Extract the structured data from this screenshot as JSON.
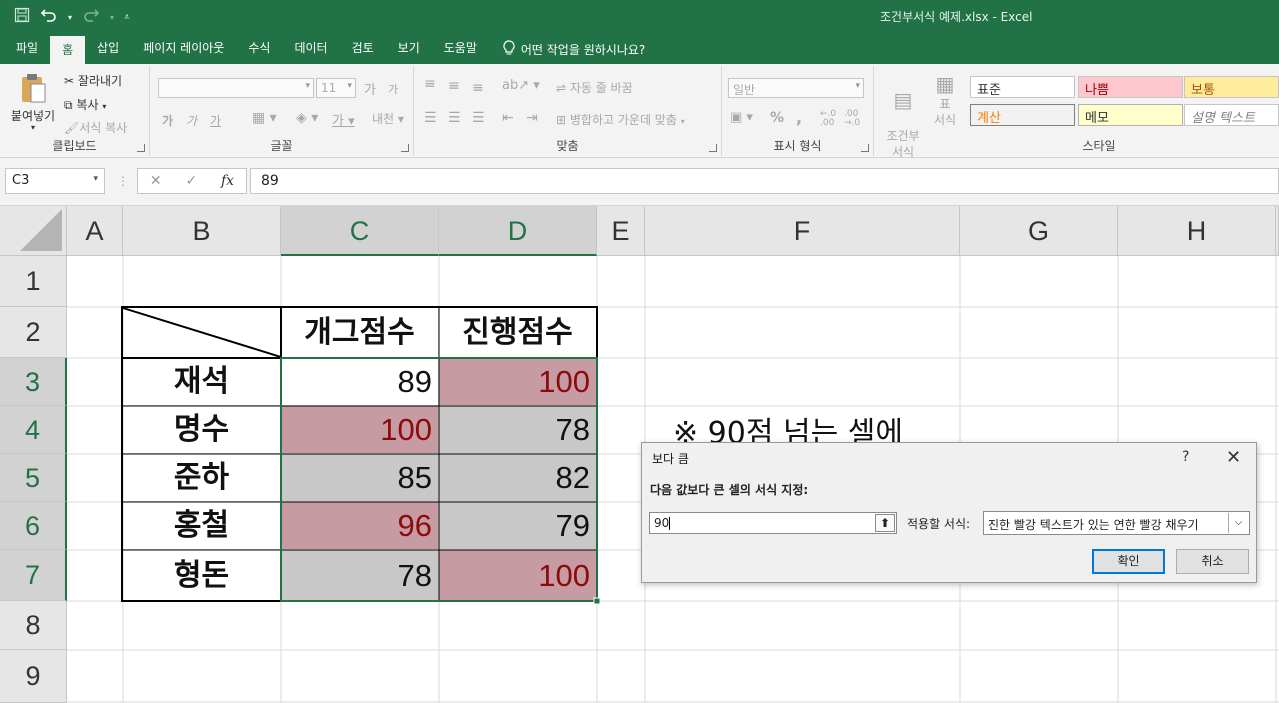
{
  "window": {
    "title": "조건부서식 예제.xlsx  -  Excel"
  },
  "qat": {
    "save_icon": "save-icon",
    "undo_icon": "undo-icon",
    "redo_icon": "redo-icon"
  },
  "tabs": [
    {
      "label": "파일",
      "active": false
    },
    {
      "label": "홈",
      "active": true
    },
    {
      "label": "삽입",
      "active": false
    },
    {
      "label": "페이지 레이아웃",
      "active": false
    },
    {
      "label": "수식",
      "active": false
    },
    {
      "label": "데이터",
      "active": false
    },
    {
      "label": "검토",
      "active": false
    },
    {
      "label": "보기",
      "active": false
    },
    {
      "label": "도움말",
      "active": false
    }
  ],
  "tellme": "어떤 작업을 원하시나요?",
  "ribbon": {
    "clipboard": {
      "paste": "붙여넣기",
      "cut": "잘라내기",
      "copy": "복사",
      "format_painter": "서식 복사",
      "label": "클립보드"
    },
    "font": {
      "font_size": "11",
      "bold": "가",
      "italic": "가",
      "underline": "가",
      "label": "글꼴"
    },
    "align": {
      "wrap": "자동 줄 바꿈",
      "merge": "병합하고 가운데 맞춤",
      "label": "맞춤"
    },
    "number": {
      "format": "일반",
      "percent": "%",
      "comma": ",",
      "label": "표시 형식"
    },
    "styles": {
      "conditional": "조건부\n서식",
      "table": "표\n서식",
      "label": "스타일",
      "items": [
        {
          "text": "표준",
          "bg": "#ffffff",
          "color": "#333333"
        },
        {
          "text": "나쁨",
          "bg": "#ffc7ce",
          "color": "#9c0006"
        },
        {
          "text": "보통",
          "bg": "#ffeb9c",
          "color": "#9c5700"
        },
        {
          "text": "계산",
          "bg": "#f2f2f2",
          "color": "#fa7d00"
        },
        {
          "text": "메모",
          "bg": "#ffffcc",
          "color": "#333333"
        },
        {
          "text": "설명 텍스트",
          "bg": "#ffffff",
          "color": "#7f7f7f"
        }
      ]
    }
  },
  "formula_bar": {
    "name_box": "C3",
    "cancel": "✕",
    "enter": "✓",
    "fx": "fx",
    "content": "89"
  },
  "sheet": {
    "columns": [
      "A",
      "B",
      "C",
      "D",
      "E",
      "F",
      "G",
      "H"
    ],
    "selected_columns": [
      "C",
      "D"
    ],
    "rows": [
      "1",
      "2",
      "3",
      "4",
      "5",
      "6",
      "7",
      "8",
      "9"
    ],
    "selected_rows": [
      "3",
      "4",
      "5",
      "6",
      "7"
    ],
    "table": {
      "headers": [
        "개그점수",
        "진행점수"
      ],
      "names": [
        "재석",
        "명수",
        "준하",
        "홍철",
        "형돈"
      ],
      "values": [
        [
          "89",
          "100"
        ],
        [
          "100",
          "78"
        ],
        [
          "85",
          "82"
        ],
        [
          "96",
          "79"
        ],
        [
          "78",
          "100"
        ]
      ],
      "highlight": [
        [
          false,
          true
        ],
        [
          true,
          false
        ],
        [
          false,
          false
        ],
        [
          true,
          false
        ],
        [
          false,
          true
        ]
      ]
    },
    "note": "※ 90점 넘는 셀에",
    "colors": {
      "highlight_bg": "#c79ba3",
      "highlight_text": "#8b0a0a",
      "selection_bg": "#c8c8c8",
      "accent": "#217346"
    }
  },
  "dialog": {
    "title": "보다 큼",
    "help": "?",
    "close": "✕",
    "prompt": "다음 값보다 큰 셀의 서식 지정:",
    "value": "90",
    "format_label": "적용할 서식:",
    "format_value": "진한 빨강 텍스트가 있는 연한 빨강 채우기",
    "ok": "확인",
    "cancel": "취소"
  }
}
